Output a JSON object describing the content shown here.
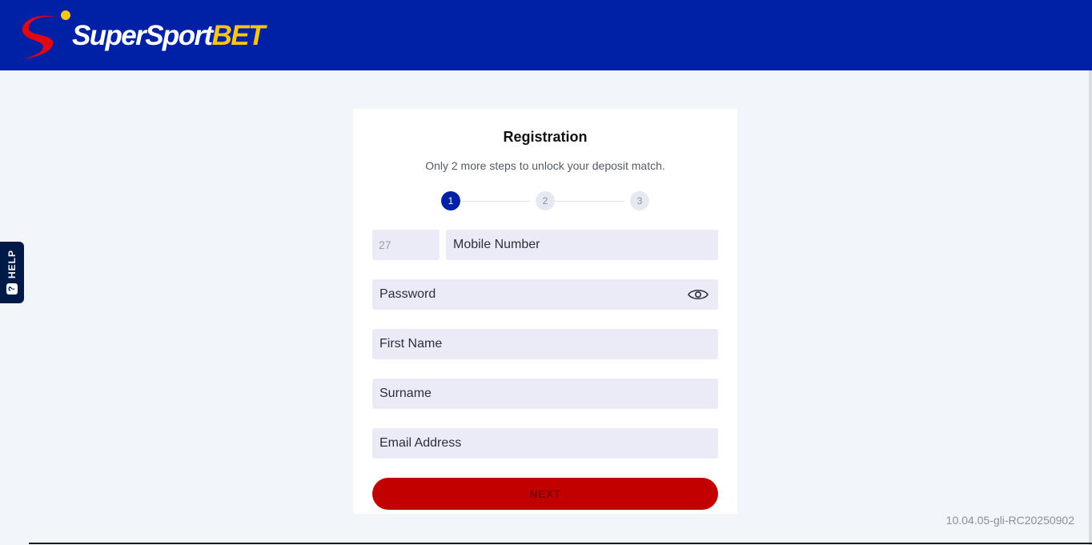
{
  "brand": {
    "name_part1": "SuperSport",
    "name_part2": "BET",
    "colors": {
      "header": "#0021a5",
      "accent": "#f5c518",
      "logo_mark": "#e30613"
    }
  },
  "help": {
    "label": "HELP",
    "icon": "?"
  },
  "registration": {
    "title": "Registration",
    "subtitle": "Only 2 more steps to unlock your deposit match.",
    "steps": [
      "1",
      "2",
      "3"
    ],
    "active_step": 1,
    "fields": {
      "country_code": {
        "value": "27"
      },
      "mobile": {
        "placeholder": "Mobile Number"
      },
      "password": {
        "placeholder": "Password",
        "icon": "eye-icon"
      },
      "first_name": {
        "placeholder": "First Name"
      },
      "surname": {
        "placeholder": "Surname"
      },
      "email": {
        "placeholder": "Email Address"
      }
    },
    "next_label": "NEXT",
    "button_color": "#c30000"
  },
  "version": "10.04.05-gli-RC20250902"
}
